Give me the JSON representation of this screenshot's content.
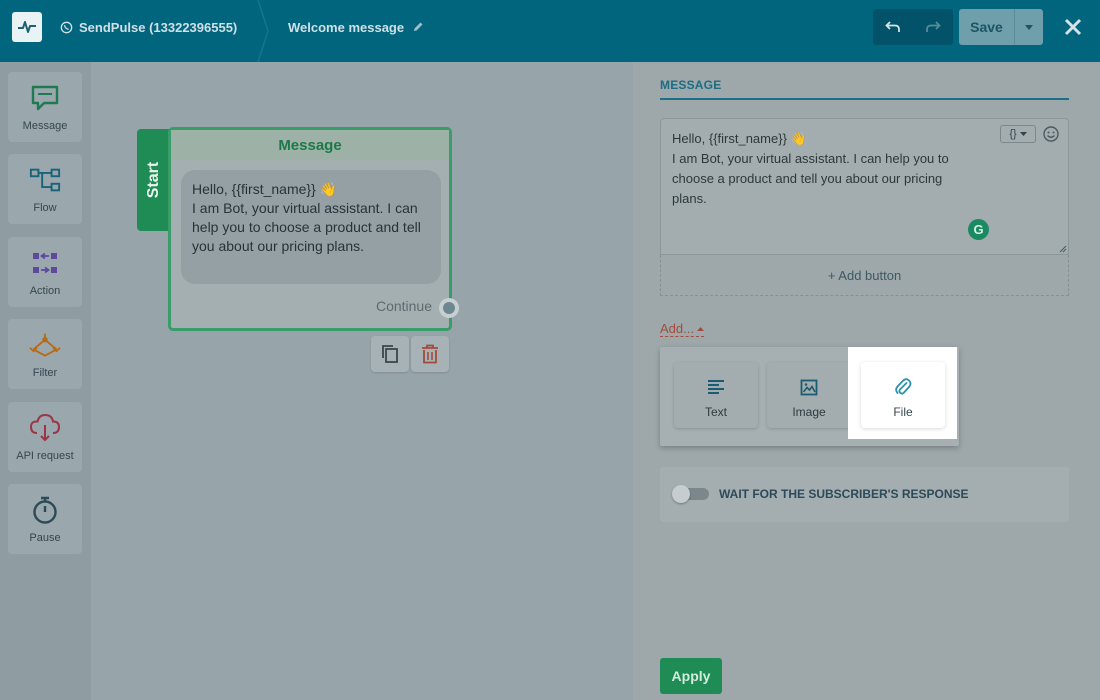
{
  "header": {
    "bot_name": "SendPulse (13322396555)",
    "flow_title": "Welcome message",
    "save_label": "Save"
  },
  "sidebar": {
    "items": [
      {
        "label": "Message",
        "icon": "message-icon"
      },
      {
        "label": "Flow",
        "icon": "flow-icon"
      },
      {
        "label": "Action",
        "icon": "action-icon"
      },
      {
        "label": "Filter",
        "icon": "filter-icon"
      },
      {
        "label": "API request",
        "icon": "api-request-icon"
      },
      {
        "label": "Pause",
        "icon": "pause-icon"
      }
    ]
  },
  "canvas": {
    "start_label": "Start",
    "node": {
      "title": "Message",
      "text_line1": "Hello,  {{first_name}} 👋",
      "text_rest": "I am Bot, your virtual assistant. I can help you to choose a product and tell you about our pricing plans.",
      "continue_label": "Continue"
    }
  },
  "panel": {
    "section_title": "MESSAGE",
    "message": {
      "line1": "Hello,  {{first_name}} 👋",
      "line2": "I am Bot, your virtual assistant. I can help you to",
      "line3": "choose a product and tell you about our pricing",
      "line4": "plans."
    },
    "variable_button": "{}",
    "add_button_label": "+ Add button",
    "add_label": "Add...",
    "add_menu": [
      {
        "label": "Text",
        "icon": "text-align-icon"
      },
      {
        "label": "Image",
        "icon": "image-icon"
      },
      {
        "label": "File",
        "icon": "paperclip-icon"
      }
    ],
    "wait_label": "WAIT FOR THE SUBSCRIBER'S RESPONSE",
    "wait_enabled": false,
    "apply_label": "Apply"
  },
  "colors": {
    "topbar": "#00657d",
    "accent_green": "#1f8b55",
    "accent_red": "#a34b3c",
    "link_blue": "#1b6d83"
  }
}
